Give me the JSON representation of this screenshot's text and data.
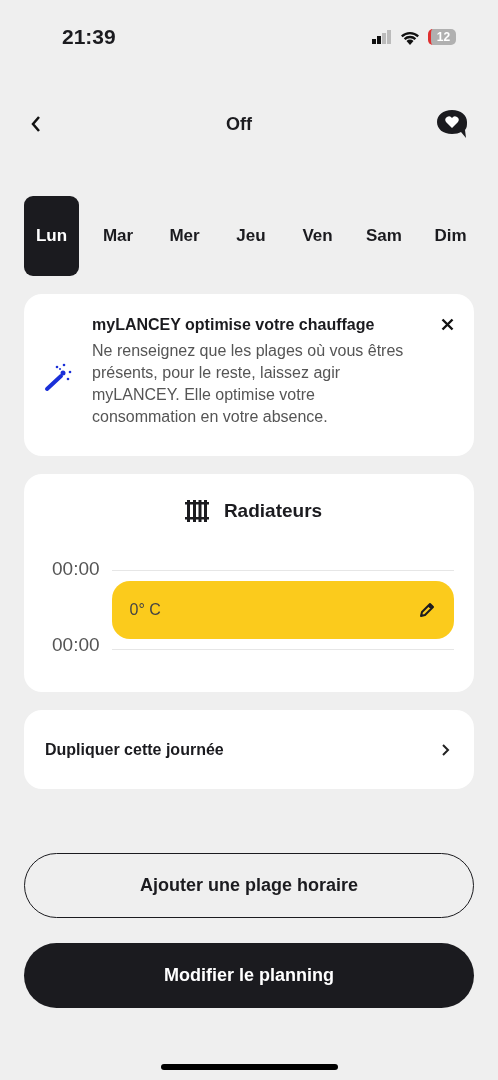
{
  "status_bar": {
    "time": "21:39",
    "battery": "12"
  },
  "header": {
    "title": "Off"
  },
  "days": [
    {
      "label": "Lun",
      "selected": true
    },
    {
      "label": "Mar",
      "selected": false
    },
    {
      "label": "Mer",
      "selected": false
    },
    {
      "label": "Jeu",
      "selected": false
    },
    {
      "label": "Ven",
      "selected": false
    },
    {
      "label": "Sam",
      "selected": false
    },
    {
      "label": "Dim",
      "selected": false
    }
  ],
  "tip": {
    "title": "myLANCEY optimise votre chauffage",
    "text": "Ne renseignez que les plages où vous êtres présents, pour le reste, laissez agir myLANCEY. Elle optimise votre consommation en votre absence."
  },
  "schedule": {
    "title": "Radiateurs",
    "start": "00:00",
    "end": "00:00",
    "slot": "0° C"
  },
  "duplicate": {
    "label": "Dupliquer cette journée"
  },
  "buttons": [
    {
      "label": "Ajouter une plage horaire",
      "kind": "outline"
    },
    {
      "label": "Modifier le planning",
      "kind": "filled"
    }
  ]
}
